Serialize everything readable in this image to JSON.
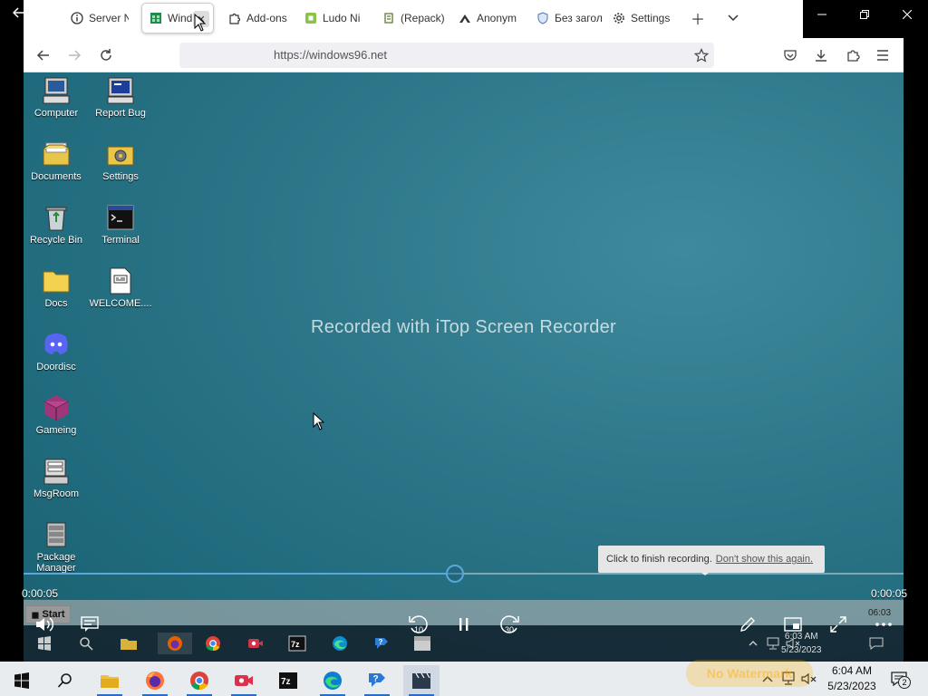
{
  "browser": {
    "tabs": [
      {
        "label": "Server N",
        "icon": "info-icon"
      },
      {
        "label": "Wind",
        "icon": "windows96-icon",
        "active": true
      },
      {
        "label": "Add-ons",
        "icon": "puzzle-icon"
      },
      {
        "label": "Ludo Ni",
        "icon": "ludo-icon"
      },
      {
        "label": "(Repack)",
        "icon": "repack-icon"
      },
      {
        "label": "Anonym",
        "icon": "anonymous-icon"
      },
      {
        "label": "Без загол",
        "icon": "shield-icon"
      },
      {
        "label": "Settings",
        "icon": "gear-icon"
      }
    ],
    "url": "https://windows96.net"
  },
  "desktop": {
    "icons": [
      {
        "label": "Computer",
        "icon": "computer-icon"
      },
      {
        "label": "Report Bug",
        "icon": "report-bug-icon"
      },
      {
        "label": "Documents",
        "icon": "documents-icon"
      },
      {
        "label": "Settings",
        "icon": "settings-icon"
      },
      {
        "label": "Recycle Bin",
        "icon": "recycle-bin-icon"
      },
      {
        "label": "Terminal",
        "icon": "terminal-icon"
      },
      {
        "label": "Docs",
        "icon": "folder-icon"
      },
      {
        "label": "WELCOME....",
        "icon": "text-file-icon"
      },
      {
        "label": "Doordisc",
        "icon": "discord-icon"
      },
      {
        "label": "Gameing",
        "icon": "cube-icon"
      },
      {
        "label": "MsgRoom",
        "icon": "msgroom-icon"
      },
      {
        "label": "Package Manager",
        "icon": "package-manager-icon"
      }
    ],
    "watermark": "Recorded with iTop Screen Recorder"
  },
  "player": {
    "bubble_text": "Click to finish recording.",
    "bubble_link": "Don't show this again.",
    "time_current": "0:00:05",
    "time_total": "0:00:05",
    "progress": 0.49,
    "skip_back": "10",
    "skip_forward": "30",
    "inner_start": "Start",
    "inner_time": "06:03",
    "inner_clock_time": "6:03 AM",
    "inner_clock_date": "5/23/2023"
  },
  "taskbar": {
    "clock_time": "6:04 AM",
    "clock_date": "5/23/2023",
    "notification_count": "2",
    "no_watermark": "No Watermark"
  },
  "colors": {
    "desktop_teal": "#2c7588",
    "player_accent": "#5aa8d8",
    "taskbar_bg": "#e8ecef"
  }
}
